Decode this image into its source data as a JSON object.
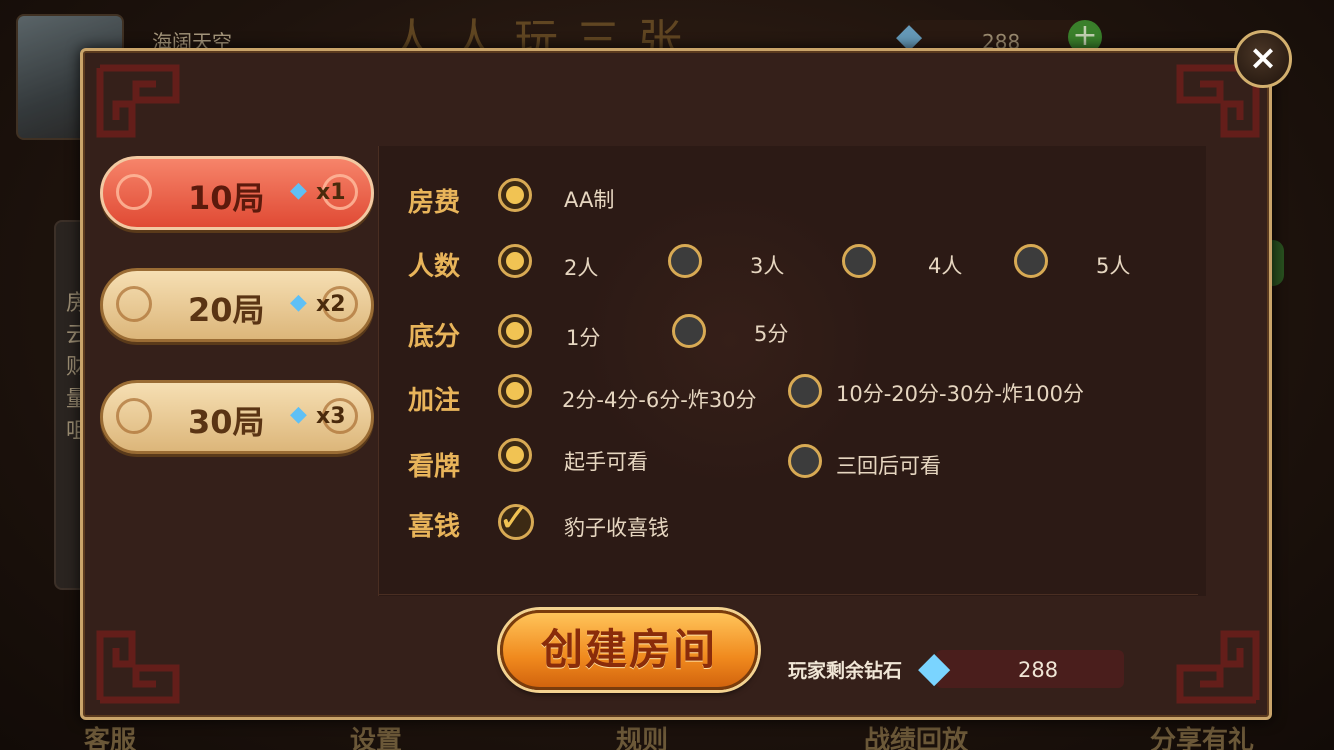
{
  "lobby": {
    "nickname": "海阔天空",
    "logo_text": "人人玩三张",
    "diamond_count": "288",
    "add_symbol": "+",
    "side_text": "房云财量咀",
    "bottom_nav": [
      "客服",
      "设置",
      "规则",
      "战绩回放",
      "分享有礼"
    ]
  },
  "dialog": {
    "close_symbol": "×",
    "rounds": [
      {
        "label": "10局",
        "multiplier": "x1",
        "active": true
      },
      {
        "label": "20局",
        "multiplier": "x2",
        "active": false
      },
      {
        "label": "30局",
        "multiplier": "x3",
        "active": false
      }
    ],
    "options": {
      "fee": {
        "label": "房费",
        "choices": [
          {
            "text": "AA制",
            "selected": true
          }
        ]
      },
      "players": {
        "label": "人数",
        "choices": [
          {
            "text": "2人",
            "selected": true
          },
          {
            "text": "3人",
            "selected": false
          },
          {
            "text": "4人",
            "selected": false
          },
          {
            "text": "5人",
            "selected": false
          }
        ]
      },
      "base": {
        "label": "底分",
        "choices": [
          {
            "text": "1分",
            "selected": true
          },
          {
            "text": "5分",
            "selected": false
          }
        ]
      },
      "bet": {
        "label": "加注",
        "choices": [
          {
            "text": "2分-4分-6分-炸30分",
            "selected": true
          },
          {
            "text": "10分-20分-30分-炸100分",
            "selected": false
          }
        ]
      },
      "look": {
        "label": "看牌",
        "choices": [
          {
            "text": "起手可看",
            "selected": true
          },
          {
            "text": "三回后可看",
            "selected": false
          }
        ]
      },
      "bonus": {
        "label": "喜钱",
        "choices": [
          {
            "text": "豹子收喜钱",
            "checked": true
          }
        ]
      }
    },
    "create_button": "创建房间",
    "remaining_label": "玩家剩余钻石",
    "remaining_count": "288"
  },
  "icons": {
    "diamond": "diamond-icon",
    "close": "close-icon",
    "check": "check-icon"
  },
  "colors": {
    "accent_gold": "#e8b45a",
    "active_tab": "#e04a34",
    "create_button": "#f08a1e"
  }
}
